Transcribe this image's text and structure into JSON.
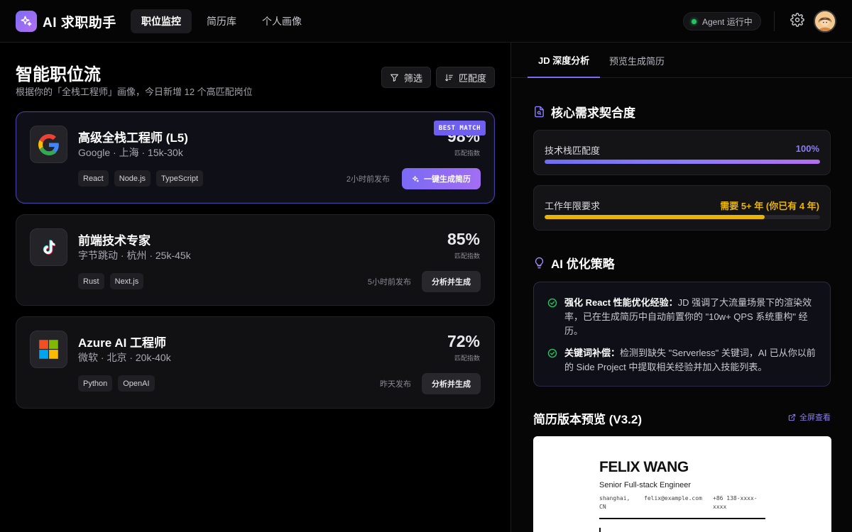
{
  "app": {
    "name": "AI 求职助手",
    "accent": "#7c6cf6"
  },
  "nav": {
    "items": [
      {
        "label": "职位监控",
        "active": true
      },
      {
        "label": "简历库",
        "active": false
      },
      {
        "label": "个人画像",
        "active": false
      }
    ]
  },
  "agent": {
    "status_label": "Agent 运行中",
    "status_color": "#22c55e"
  },
  "feed": {
    "title": "智能职位流",
    "subtitle": "根据你的「全栈工程师」画像，今日新增 12 个高匹配岗位",
    "filter_label": "筛选",
    "sort_label": "匹配度",
    "score_label": "匹配指数",
    "best_badge": "BEST MATCH",
    "jobs": [
      {
        "title": "高级全栈工程师 (L5)",
        "meta": "Google · 上海 · 15k-30k",
        "tags": [
          "React",
          "Node.js",
          "TypeScript"
        ],
        "score": "98%",
        "posted": "2小时前发布",
        "action": "一键生成简历",
        "logo": "google-logo"
      },
      {
        "title": "前端技术专家",
        "meta": "字节跳动 · 杭州 · 25k-45k",
        "tags": [
          "Rust",
          "Next.js"
        ],
        "score": "85%",
        "posted": "5小时前发布",
        "action": "分析并生成",
        "logo": "tiktok-logo"
      },
      {
        "title": "Azure AI 工程师",
        "meta": "微软 · 北京 · 20k-40k",
        "tags": [
          "Python",
          "OpenAI"
        ],
        "score": "72%",
        "posted": "昨天发布",
        "action": "分析并生成",
        "logo": "microsoft-logo"
      }
    ]
  },
  "analysis": {
    "tabs": [
      {
        "label": "JD 深度分析",
        "active": true
      },
      {
        "label": "预览生成简历",
        "active": false
      }
    ],
    "core_title": "核心需求契合度",
    "metrics": [
      {
        "label": "技术栈匹配度",
        "value": "100%",
        "fill": 1.0,
        "color": "#8b7cf8"
      },
      {
        "label": "工作年限要求",
        "value": "需要 5+ 年 (你已有 4 年)",
        "fill": 0.8,
        "color": "#eab308"
      }
    ],
    "strategy_title": "AI 优化策略",
    "strategies": [
      {
        "heading": "强化 React 性能优化经验：",
        "text": "JD 强调了大流量场景下的渲染效率，已在生成简历中自动前置你的 \"10w+ QPS 系统重构\" 经历。"
      },
      {
        "heading": "关键词补偿：",
        "text": "检测到缺失 \"Serverless\" 关键词，AI 已从你以前的 Side Project 中提取相关经验并加入技能列表。"
      }
    ],
    "preview_title": "简历版本预览 (V3.2)",
    "fullscreen_label": "全屏查看"
  },
  "resume": {
    "name": "FELIX WANG",
    "role": "Senior Full-stack Engineer",
    "location": "shanghai, CN",
    "email": "felix@example.com",
    "phone": "+86 138-xxxx-xxxx"
  }
}
